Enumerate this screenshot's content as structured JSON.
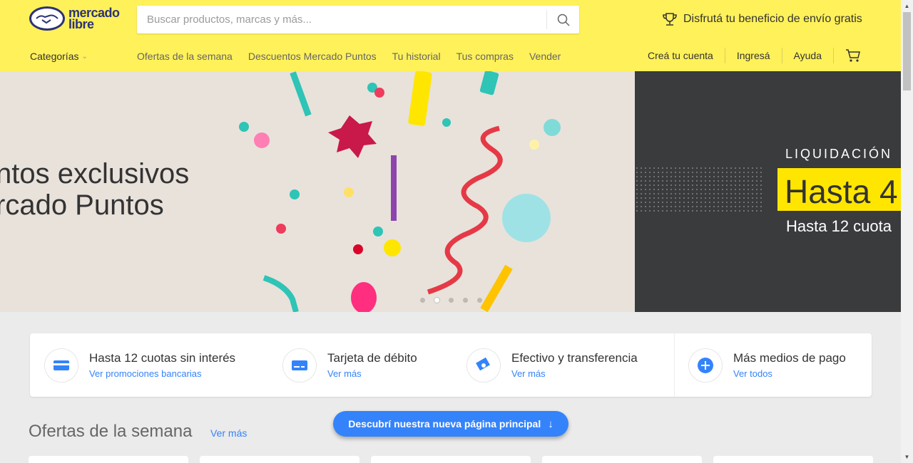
{
  "header": {
    "logo_line1": "mercado",
    "logo_line2": "libre",
    "search_placeholder": "Buscar productos, marcas y más...",
    "promo_text": "Disfrutá tu beneficio de envío gratis",
    "categories_label": "Categorías",
    "nav_links": [
      "Ofertas de la semana",
      "Descuentos Mercado Puntos",
      "Tu historial",
      "Tus compras",
      "Vender"
    ],
    "account_links": [
      "Creá tu cuenta",
      "Ingresá",
      "Ayuda"
    ]
  },
  "hero": {
    "slide1_line1": "ntos exclusivos",
    "slide1_line2": "rcado Puntos",
    "slide2_label": "LIQUIDACIÓN",
    "slide2_headline": "Hasta 4",
    "slide2_sub": "Hasta 12 cuota",
    "dots_count": 5,
    "active_dot": 2
  },
  "payments": [
    {
      "title": "Hasta 12 cuotas sin interés",
      "link": "Ver promociones bancarias",
      "icon": "credit-card-icon"
    },
    {
      "title": "Tarjeta de débito",
      "link": "Ver más",
      "icon": "debit-card-icon"
    },
    {
      "title": "Efectivo y transferencia",
      "link": "Ver más",
      "icon": "cash-icon"
    },
    {
      "title": "Más medios de pago",
      "link": "Ver todos",
      "icon": "plus-icon"
    }
  ],
  "section": {
    "title": "Ofertas de la semana",
    "link": "Ver más"
  },
  "float_button": "Descubrí nuestra nueva página principal",
  "colors": {
    "brand_yellow": "#fff159",
    "accent_blue": "#3483fa",
    "brand_navy": "#2d3277"
  }
}
